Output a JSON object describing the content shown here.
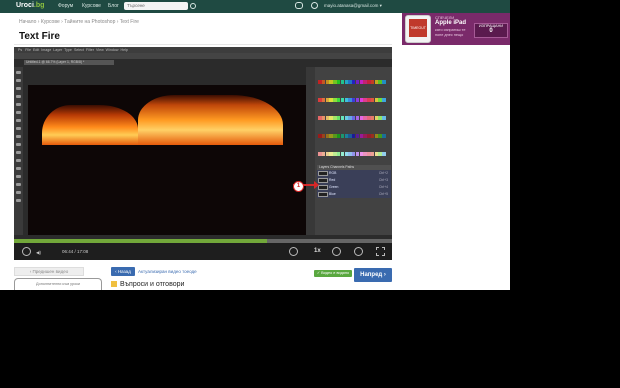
{
  "header": {
    "logo": "Uroci",
    "logo_accent": ".bg",
    "nav": [
      "Форум",
      "Курсове",
      "Блог"
    ],
    "search_placeholder": "Търсене",
    "user": "mayio.atanasa@gmail.com ▾"
  },
  "ad": {
    "eyebrow": "СПЕЧЕЛИ",
    "headline": "Apple iPad",
    "body": "като изпратиш те поне днес нещо",
    "device_label": "TIMEOUT",
    "button_label": "ИЗПРАЩАНИ",
    "button_count": "0"
  },
  "breadcrumb": "Начало › Курсове › Тайните на Photoshop › Text Fire",
  "page_title": "Text Fire",
  "photoshop": {
    "menu": [
      "Ps",
      "File",
      "Edit",
      "Image",
      "Layer",
      "Type",
      "Select",
      "Filter",
      "View",
      "Window",
      "Help"
    ],
    "doc_tab": "Untitled-1 @ 66.7% (Layer 1, RGB/8) *",
    "panel_tabs": "Layers  Channels  Paths",
    "channels": [
      {
        "name": "RGB",
        "key": "Ctrl+2"
      },
      {
        "name": "Red",
        "key": "Ctrl+3"
      },
      {
        "name": "Green",
        "key": "Ctrl+4"
      },
      {
        "name": "Blue",
        "key": "Ctrl+5"
      }
    ],
    "callout": "1"
  },
  "player": {
    "progress": 0.67,
    "time": "06:44 / 17:08",
    "speed": "1x"
  },
  "below": {
    "prev_button": "‹ Предишен видео",
    "next_box": "Дополнителни към уроки",
    "back_button": "‹ Назад",
    "top_link": "Актуализиран видео тоеоде",
    "done_button": "✓ Видео е видяно",
    "next_button": "Напред ›",
    "qa_heading": "Въпроси и отговори"
  },
  "colors": {
    "topbar": "#1f4a42",
    "accent_blue": "#3a6bb0",
    "accent_green": "#5aa840",
    "ad_bg": "#7a2a6a",
    "arrow": "#d62828"
  }
}
